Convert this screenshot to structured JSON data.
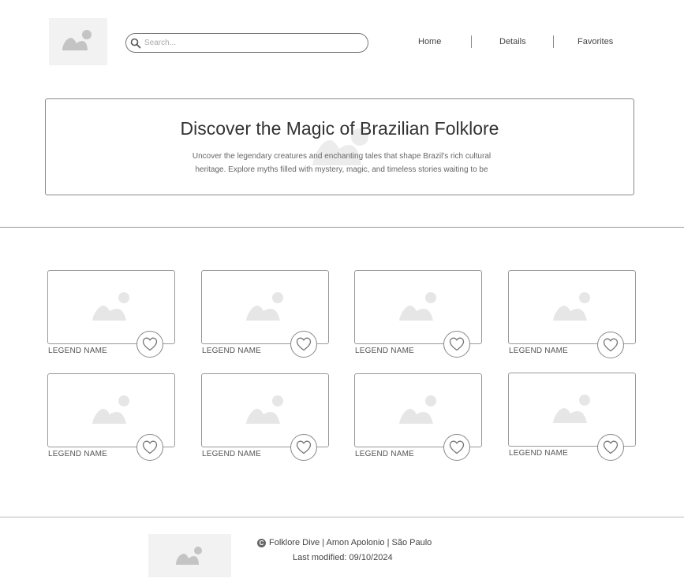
{
  "header": {
    "logo_icon": "image-placeholder-icon",
    "search": {
      "placeholder": "Search...",
      "value": ""
    },
    "nav": [
      {
        "label": "Home"
      },
      {
        "label": "Details"
      },
      {
        "label": "Favorites"
      }
    ]
  },
  "hero": {
    "title": "Discover the Magic of Brazilian Folklore",
    "description": "Uncover the legendary creatures and enchanting tales that shape Brazil's rich cultural heritage. Explore myths filled with mystery, magic, and timeless stories waiting to be"
  },
  "cards": [
    {
      "name": "LEGEND NAME",
      "favorite": false
    },
    {
      "name": "LEGEND NAME",
      "favorite": false
    },
    {
      "name": "LEGEND NAME",
      "favorite": false
    },
    {
      "name": "LEGEND NAME",
      "favorite": false
    },
    {
      "name": "LEGEND NAME",
      "favorite": false
    },
    {
      "name": "LEGEND NAME",
      "favorite": false
    },
    {
      "name": "LEGEND NAME",
      "favorite": false
    },
    {
      "name": "LEGEND NAME",
      "favorite": false
    }
  ],
  "footer": {
    "copyright_symbol": "C",
    "credits": "Folklore Dive | Amon Apolonio | São Paulo",
    "last_modified": "Last modified: 09/10/2024"
  },
  "colors": {
    "border": "#999999",
    "placeholder_bg": "#f2f2f2",
    "placeholder_fg": "#c4c4c4",
    "text": "#444444"
  }
}
